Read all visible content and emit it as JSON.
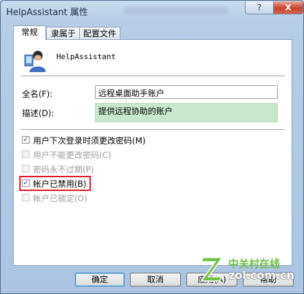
{
  "window": {
    "title": "HelpAssistant 属性",
    "help_button": "?",
    "close_button": "X"
  },
  "tabs": [
    {
      "label": "常规",
      "active": true
    },
    {
      "label": "隶属于",
      "active": false
    },
    {
      "label": "配置文件",
      "active": false
    }
  ],
  "general": {
    "user_icon": "user-account-icon",
    "username": "HelpAssistant",
    "fullname_label": "全名(F):",
    "fullname_value": "远程桌面助手账户",
    "description_label": "描述(D):",
    "description_value": "提供远程协助的账户",
    "description_highlight_color": "#c8e8cc"
  },
  "checkboxes": [
    {
      "label": "用户下次登录时须更改密码(M)",
      "checked": true,
      "enabled": true
    },
    {
      "label": "用户不能更改密码(C)",
      "checked": false,
      "enabled": false
    },
    {
      "label": "密码永不过期(P)",
      "checked": false,
      "enabled": false
    },
    {
      "label": "帐户已禁用(B)",
      "checked": true,
      "enabled": true,
      "highlighted": true
    },
    {
      "label": "帐户已锁定(O)",
      "checked": false,
      "enabled": false
    }
  ],
  "highlight_color": "#e3141f",
  "buttons": {
    "ok": "确定",
    "cancel": "取消",
    "apply": "应用(A)",
    "help": "帮助"
  },
  "watermark": {
    "cn": "中关村在线",
    "en": "zol.com.cn"
  }
}
